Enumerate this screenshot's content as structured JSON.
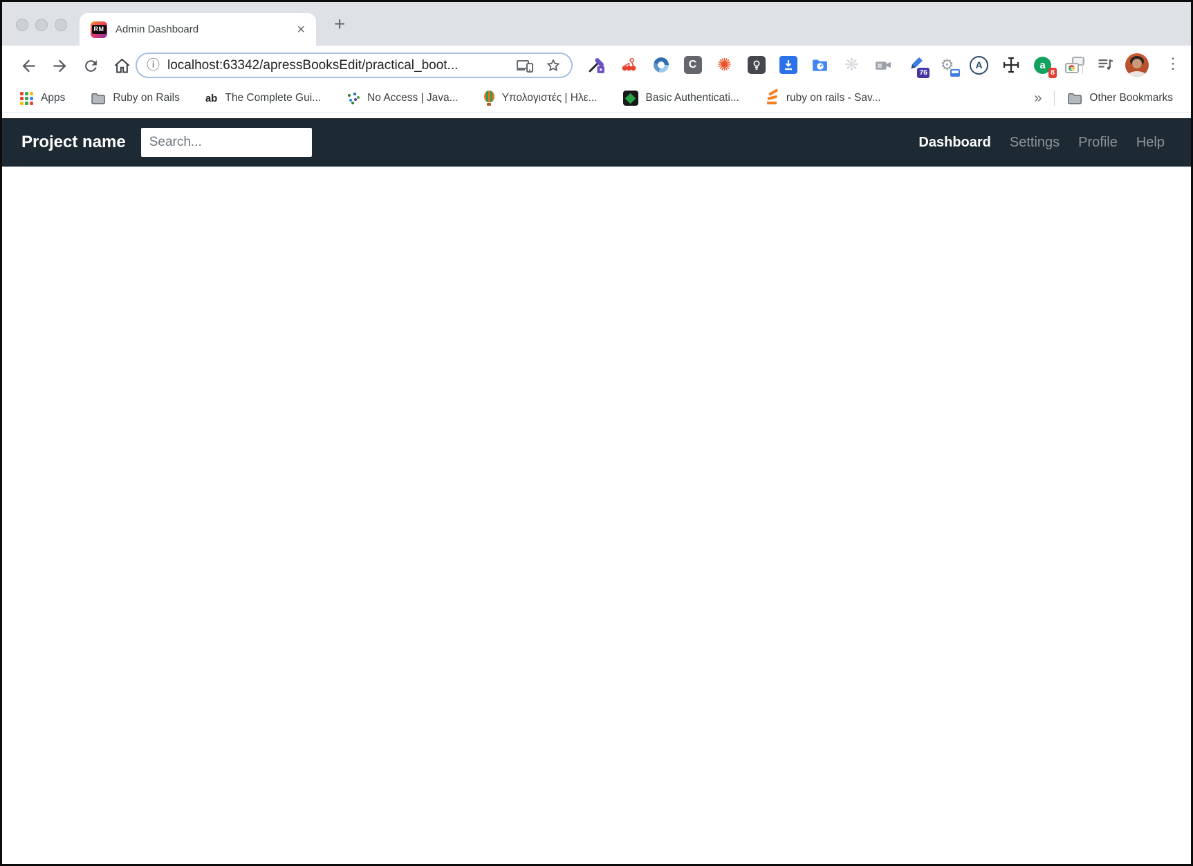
{
  "window_controls": {
    "buttons": [
      "close",
      "minimize",
      "zoom"
    ]
  },
  "tab_bar": {
    "tab_title": "Admin Dashboard",
    "favicon_text": "RM",
    "close_glyph": "×",
    "new_tab_glyph": "+"
  },
  "toolbar": {
    "url": "localhost:63342/apressBooksEdit/practical_boot...",
    "info_glyph": "ⓘ",
    "menu_glyph": "⋮",
    "extensions": {
      "c_label": "C",
      "gear_flower_glyph": "✺",
      "disabled_flower_glyph": "❋",
      "gear_glyph": "⚙",
      "a_circle_label": "A",
      "adblock_label": "a",
      "pen_badge": "76",
      "adblock_badge": "8"
    }
  },
  "bookmarks_bar": {
    "ab_glyph": "ab",
    "overflow_glyph": "»",
    "items": [
      {
        "label": "Apps"
      },
      {
        "label": "Ruby on Rails"
      },
      {
        "label": "The Complete Gui..."
      },
      {
        "label": "No Access | Java..."
      },
      {
        "label": "Υπολογιστές | Ηλε..."
      },
      {
        "label": "Basic Authenticati..."
      },
      {
        "label": "ruby on rails - Sav..."
      }
    ],
    "other_bookmarks_label": "Other Bookmarks"
  },
  "page": {
    "navbar": {
      "brand": "Project name",
      "search_placeholder": "Search...",
      "links": [
        {
          "label": "Dashboard",
          "active": true
        },
        {
          "label": "Settings",
          "active": false
        },
        {
          "label": "Profile",
          "active": false
        },
        {
          "label": "Help",
          "active": false
        }
      ]
    },
    "colors": {
      "navbar_bg": "#1e2a33",
      "active_link": "#ffffff",
      "inactive_link": "#8d969c",
      "omnibox_outline": "#a6bfe2"
    }
  }
}
